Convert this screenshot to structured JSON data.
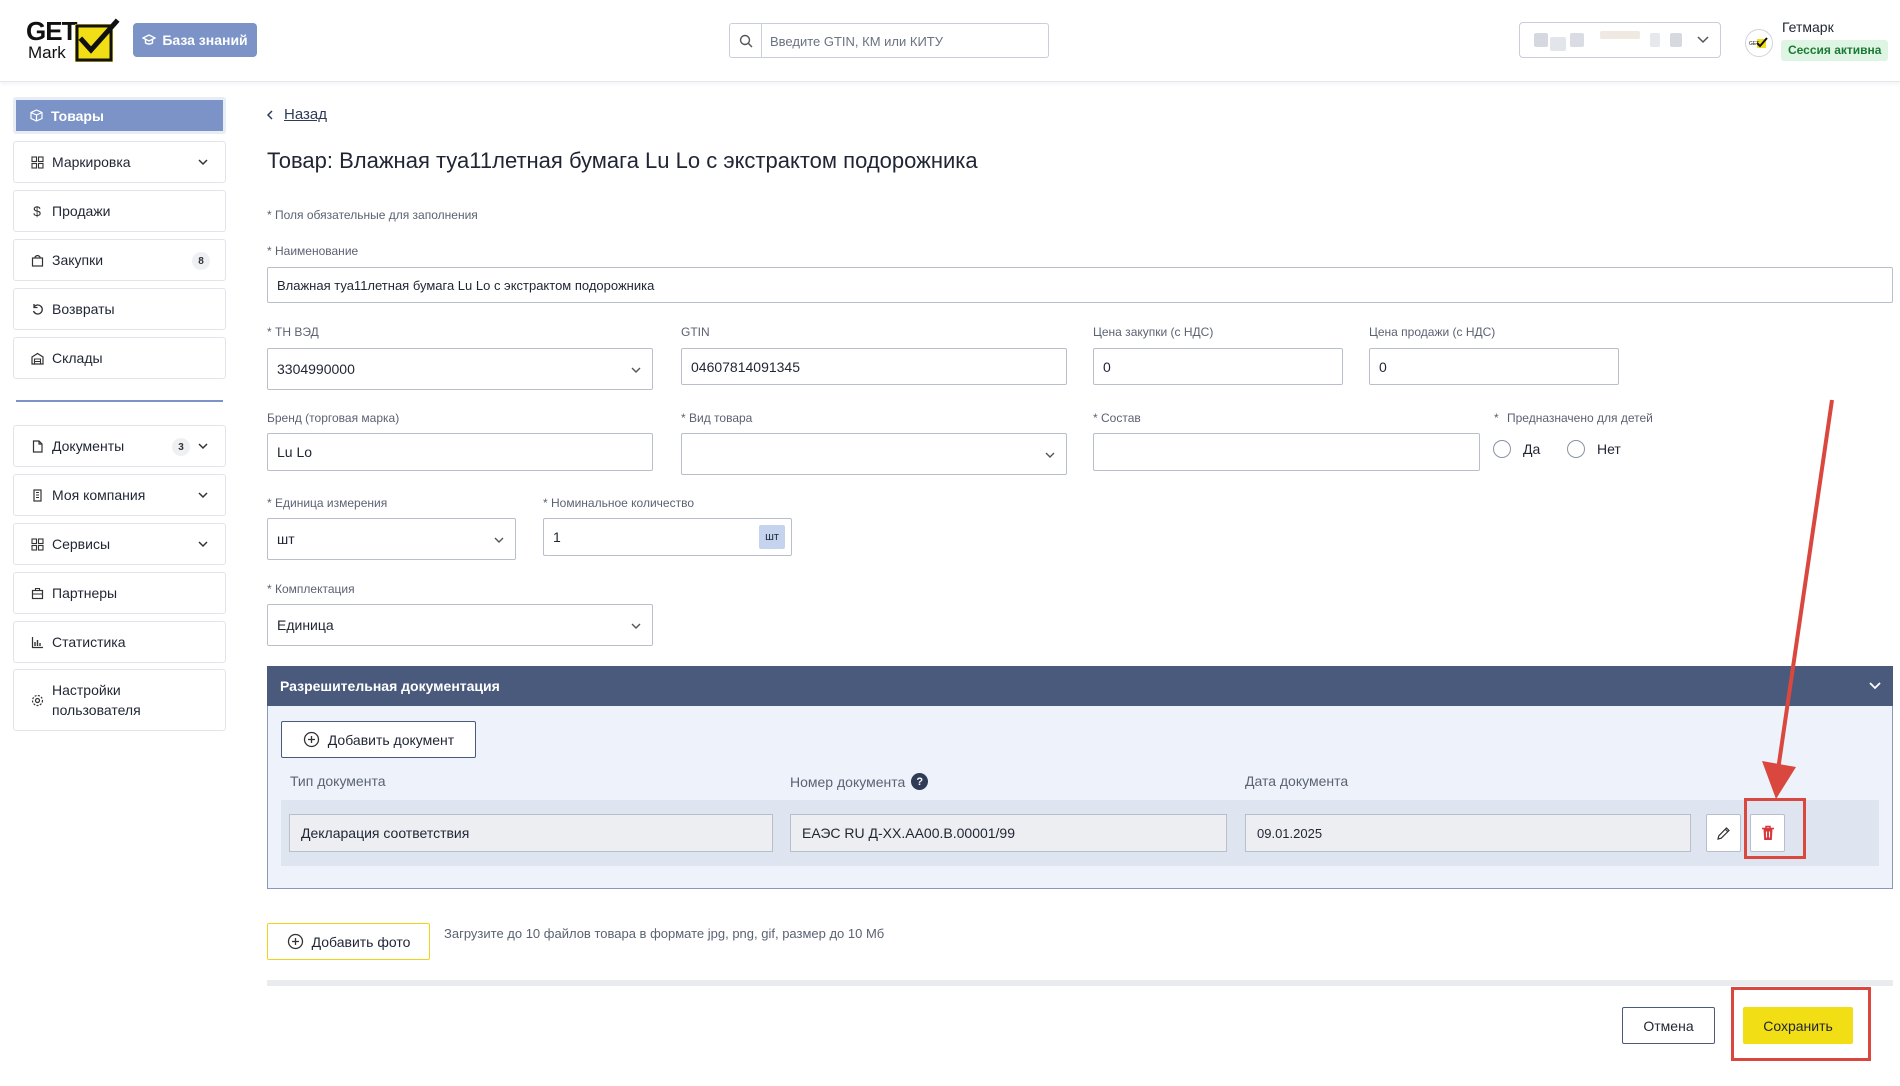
{
  "header": {
    "logo_top": "GET",
    "logo_bottom": "Mark",
    "knowledge_base": "База знаний",
    "search_placeholder": "Введите GTIN, КМ или КИТУ",
    "user_name": "Гетмарк",
    "session_status": "Сессия активна"
  },
  "sidebar": {
    "items": [
      {
        "label": "Товары",
        "icon": "box-icon",
        "active": true
      },
      {
        "label": "Маркировка",
        "icon": "grid-icon",
        "expandable": true
      },
      {
        "label": "Продажи",
        "icon": "dollar-icon"
      },
      {
        "label": "Закупки",
        "icon": "bag-icon",
        "badge": "8"
      },
      {
        "label": "Возвраты",
        "icon": "return-icon"
      },
      {
        "label": "Склады",
        "icon": "warehouse-icon"
      },
      {
        "label": "Документы",
        "icon": "document-icon",
        "badge": "3",
        "expandable": true
      },
      {
        "label": "Моя компания",
        "icon": "building-icon",
        "expandable": true
      },
      {
        "label": "Сервисы",
        "icon": "grid-icon",
        "expandable": true
      },
      {
        "label": "Партнеры",
        "icon": "partners-icon"
      },
      {
        "label": "Статистика",
        "icon": "chart-icon"
      },
      {
        "label": "Настройки пользователя",
        "label_line1": "Настройки",
        "label_line2": "пользователя",
        "icon": "gear-icon"
      }
    ]
  },
  "page": {
    "back_label": "Назад",
    "title": "Товар: Влажная туа11летная бумага Lu Lo с экстрактом подорожника",
    "required_note": "* Поля обязательные для заполнения"
  },
  "form": {
    "name_label": "* Наименование",
    "name_value": "Влажная туа11летная бумага Lu Lo с экстрактом подорожника",
    "tnved_label": "* ТН ВЭД",
    "tnved_value": "3304990000",
    "gtin_label": "GTIN",
    "gtin_value": "04607814091345",
    "purchase_price_label": "Цена закупки (с НДС)",
    "purchase_price_value": "0",
    "sale_price_label": "Цена продажи (с НДС)",
    "sale_price_value": "0",
    "brand_label": "Бренд (торговая марка)",
    "brand_value": "Lu Lo",
    "product_type_label": "* Вид товара",
    "product_type_value": "",
    "composition_label": "* Состав",
    "composition_value": "",
    "for_children_label": "Предназначено для детей",
    "for_children_star": "*",
    "yes_label": "Да",
    "no_label": "Нет",
    "unit_label": "* Единица измерения",
    "unit_value": "шт",
    "nominal_qty_label": "* Номинальное количество",
    "nominal_qty_value": "1",
    "nominal_qty_unit": "шт",
    "kit_label": "* Комплектация",
    "kit_value": "Единица"
  },
  "docs": {
    "section_title": "Разрешительная документация",
    "add_button": "Добавить документ",
    "col_type": "Тип документа",
    "col_number": "Номер документа",
    "col_date": "Дата документа",
    "rows": [
      {
        "type": "Декларация соответствия",
        "number": "ЕАЭС  RU Д-ХХ.АА00.В.00001/99",
        "date": "09.01.2025"
      }
    ]
  },
  "photos": {
    "add_button": "Добавить фото",
    "hint": "Загрузите до 10 файлов товара в формате jpg, png, gif, размер до 10 Мб"
  },
  "actions": {
    "cancel": "Отмена",
    "save": "Сохранить"
  },
  "colors": {
    "accent": "#7b93c7",
    "section_header": "#4a5a7c",
    "save_button": "#f2de14",
    "annotation": "#d9473e",
    "delete_icon": "#d9363e"
  }
}
